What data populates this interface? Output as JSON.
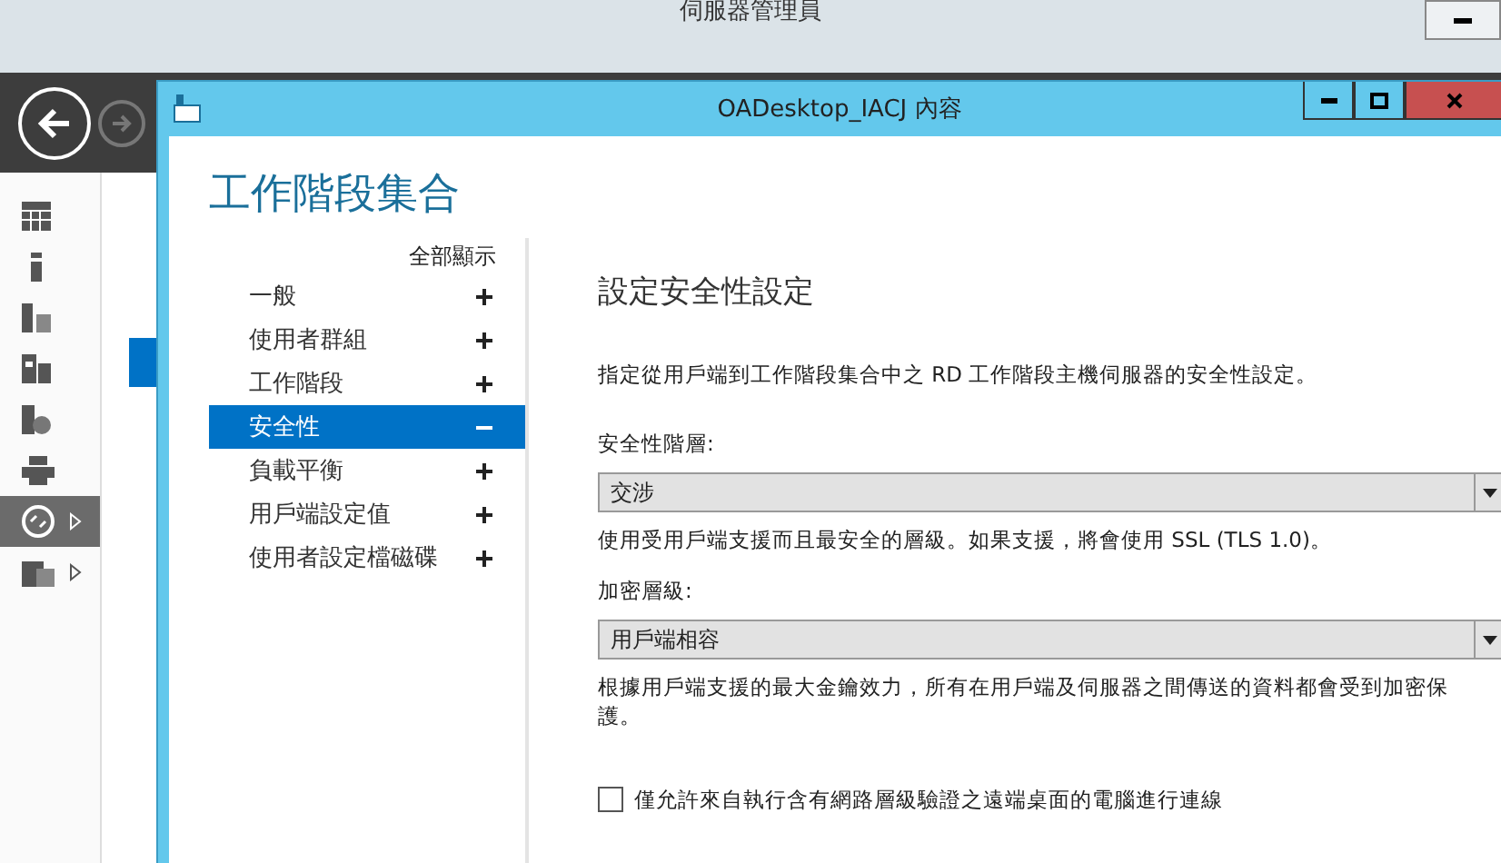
{
  "background_window": {
    "title": "伺服器管理員",
    "tool_icons": [
      {
        "kind": "grid",
        "selected": false,
        "expandable": false
      },
      {
        "kind": "server",
        "selected": false,
        "expandable": false
      },
      {
        "kind": "servers",
        "selected": false,
        "expandable": false
      },
      {
        "kind": "files",
        "selected": false,
        "expandable": false
      },
      {
        "kind": "web",
        "selected": false,
        "expandable": false
      },
      {
        "kind": "printer",
        "selected": false,
        "expandable": false
      },
      {
        "kind": "remote",
        "selected": true,
        "expandable": true
      },
      {
        "kind": "folder",
        "selected": false,
        "expandable": true
      }
    ],
    "nav_items": [
      {
        "selected": false
      },
      {
        "selected": false
      },
      {
        "selected": false
      },
      {
        "selected": true
      }
    ]
  },
  "dialog": {
    "title": "OADesktop_IACJ 內容",
    "heading": "工作階段集合",
    "show_all": "全部顯示",
    "sections": [
      {
        "label": "一般",
        "expanded": false
      },
      {
        "label": "使用者群組",
        "expanded": false
      },
      {
        "label": "工作階段",
        "expanded": false
      },
      {
        "label": "安全性",
        "expanded": true
      },
      {
        "label": "負載平衡",
        "expanded": false
      },
      {
        "label": "用戶端設定值",
        "expanded": false
      },
      {
        "label": "使用者設定檔磁碟",
        "expanded": false
      }
    ],
    "content": {
      "heading": "設定安全性設定",
      "description": "指定從用戶端到工作階段集合中之 RD 工作階段主機伺服器的安全性設定。",
      "fields": [
        {
          "label": "安全性階層:",
          "value": "交涉",
          "hint": "使用受用戶端支援而且最安全的層級。如果支援，將會使用 SSL (TLS 1.0)。"
        },
        {
          "label": "加密層級:",
          "value": "用戶端相容",
          "hint": "根據用戶端支援的最大金鑰效力，所有在用戶端及伺服器之間傳送的資料都會受到加密保護。"
        }
      ],
      "checkbox": {
        "label": "僅允許來自執行含有網路層級驗證之遠端桌面的電腦進行連線",
        "checked": false
      }
    }
  }
}
